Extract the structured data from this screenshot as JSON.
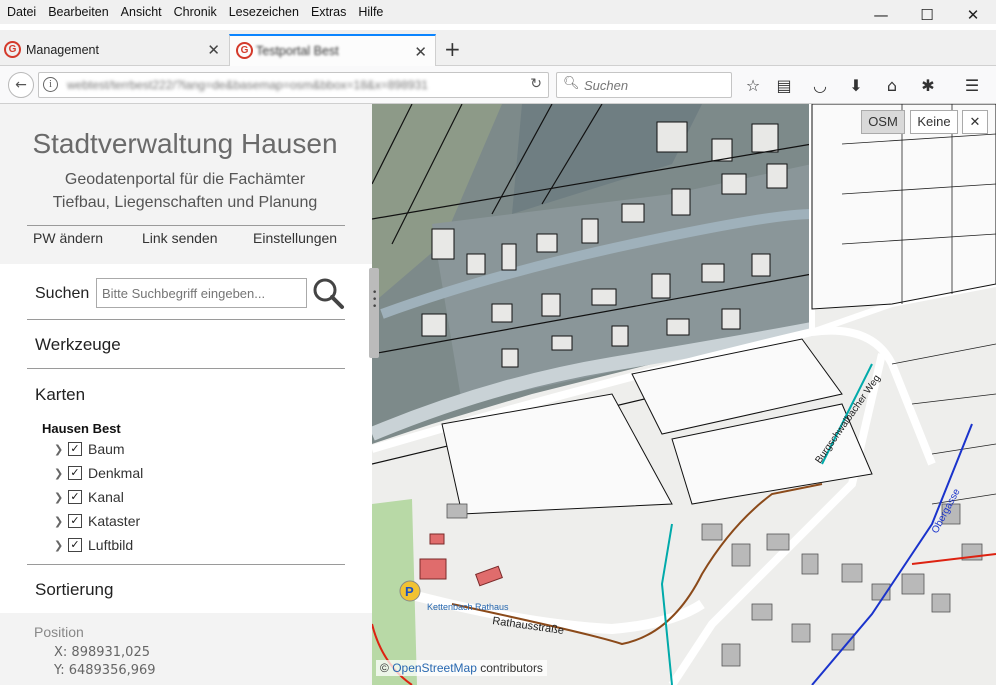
{
  "browser": {
    "menu": [
      "Datei",
      "Bearbeiten",
      "Ansicht",
      "Chronik",
      "Lesezeichen",
      "Extras",
      "Hilfe"
    ],
    "window_controls": {
      "minimize": "—",
      "maximize": "☐",
      "close": "✕"
    },
    "tabs": [
      {
        "label": "Management",
        "active": false
      },
      {
        "label": "Testportal Best",
        "active": true
      }
    ],
    "new_tab": "+",
    "url": "webtest/terrbest222/?lang=de&basemap=osm&bbox=18&x=898931",
    "search_placeholder": "Suchen",
    "toolbar_icons": [
      "bookmark-star-icon",
      "reader-icon",
      "pocket-icon",
      "download-icon",
      "home-icon",
      "extension-icon",
      "menu-icon"
    ]
  },
  "sidebar": {
    "title": "Stadtverwaltung Hausen",
    "subtitle_line1": "Geodatenportal für die Fachämter",
    "subtitle_line2": "Tiefbau, Liegenschaften und Planung",
    "links": [
      "PW ändern",
      "Link senden",
      "Einstellungen"
    ],
    "search_label": "Suchen",
    "search_placeholder": "Bitte Suchbegriff eingeben...",
    "sections": {
      "tools": "Werkzeuge",
      "maps": "Karten",
      "sort": "Sortierung"
    },
    "layer_group": "Hausen Best",
    "layers": [
      {
        "label": "Baum",
        "checked": true
      },
      {
        "label": "Denkmal",
        "checked": true
      },
      {
        "label": "Kanal",
        "checked": true
      },
      {
        "label": "Kataster",
        "checked": true
      },
      {
        "label": "Luftbild",
        "checked": true
      }
    ],
    "position_label": "Position",
    "position_x": "X:  898931,025",
    "position_y": "Y:  6489356,969"
  },
  "map": {
    "basemap_buttons": [
      "OSM",
      "Keine"
    ],
    "close": "✕",
    "street_labels": [
      "Rathausstraße",
      "Burgschwalbacher Weg",
      "Obergasse",
      "Kettenbach Rathaus"
    ],
    "attribution_prefix": "© ",
    "attribution_link": "OpenStreetMap",
    "attribution_suffix": " contributors"
  }
}
